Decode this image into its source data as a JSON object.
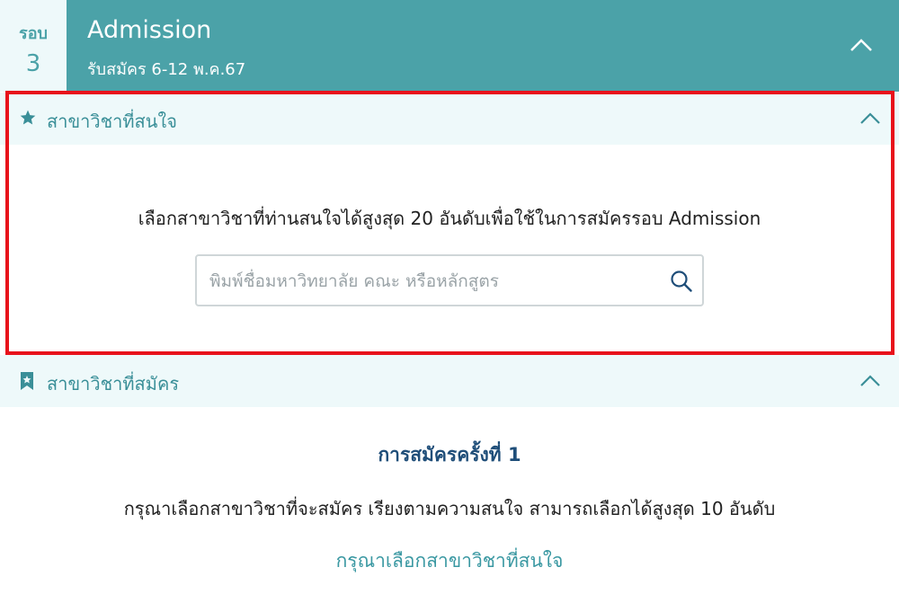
{
  "header": {
    "round_label": "รอบ",
    "round_number": "3",
    "title": "Admission",
    "subtitle": "รับสมัคร 6-12 พ.ค.67"
  },
  "interested": {
    "title": "สาขาวิชาที่สนใจ",
    "description": "เลือกสาขาวิชาที่ท่านสนใจได้สูงสุด 20 อันดับเพื่อใช้ในการสมัครรอบ Admission",
    "search_placeholder": "พิมพ์ชื่อมหาวิทยาลัย คณะ หรือหลักสูตร",
    "search_value": ""
  },
  "applied": {
    "title": "สาขาวิชาที่สมัคร",
    "round_heading": "การสมัครครั้งที่ 1",
    "description": "กรุณาเลือกสาขาวิชาที่จะสมัคร เรียงตามความสนใจ สามารถเลือกได้สูงสุด 10 อันดับ",
    "link_label": "กรุณาเลือกสาขาวิชาที่สนใจ"
  },
  "icons": {
    "header_collapse": "chevron-up-icon",
    "interested_icon": "star-icon",
    "applied_icon": "bookmark-icon",
    "search": "search-icon"
  },
  "colors": {
    "header_bg": "#4ba2a8",
    "section_bg": "#eef9fa",
    "accent_text": "#3a8f98",
    "highlight_border": "#e8121b",
    "round_heading": "#1f4e79"
  }
}
